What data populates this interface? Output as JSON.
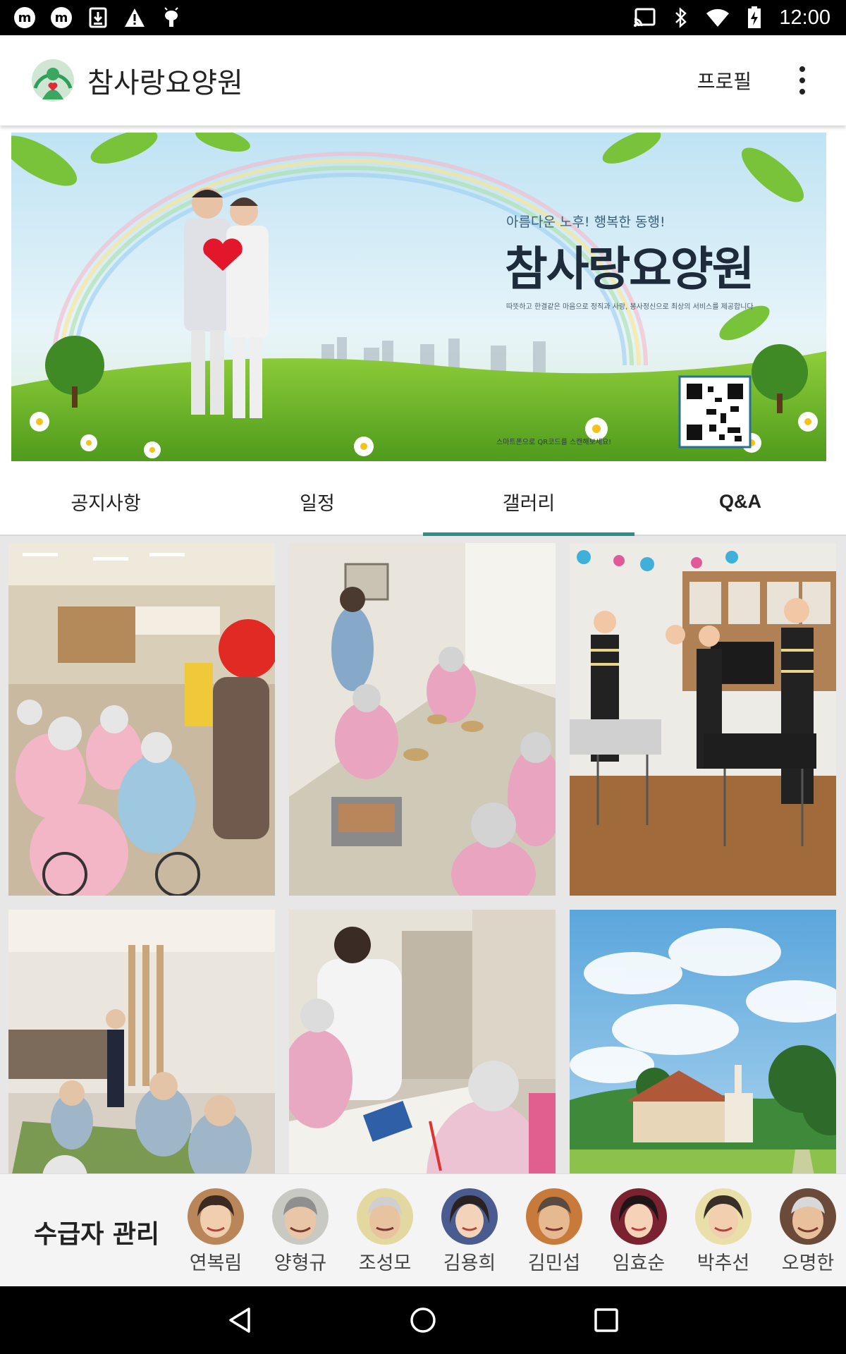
{
  "status_bar": {
    "time": "12:00",
    "left_icons": [
      "m-cast-icon",
      "m-app-icon",
      "download-icon",
      "warning-icon",
      "android-icon"
    ],
    "right_icons": [
      "cast-icon",
      "bluetooth-icon",
      "wifi-icon",
      "battery-charging-icon"
    ]
  },
  "app_bar": {
    "title": "참사랑요양원",
    "profile_label": "프로필",
    "accent": "#2b8f84"
  },
  "banner": {
    "tagline": "아름다운 노후! 행복한 동행!",
    "name": "참사랑요양원",
    "description": "따뜻하고 한결같은 마음으로 정직과 사랑, 봉사정신으로 최상의 서비스를 제공합니다",
    "qr_caption": "스마트폰으로 QR코드를 스캔해보세요!"
  },
  "tabs": [
    {
      "label": "공지사항",
      "active": false
    },
    {
      "label": "일정",
      "active": false
    },
    {
      "label": "갤러리",
      "active": true
    },
    {
      "label": "Q&A",
      "active": false
    }
  ],
  "gallery": {
    "photos": [
      "recreation-photo",
      "meal-photo",
      "music-performance-photo",
      "activity-room-photo",
      "care-photo",
      "building-photo"
    ]
  },
  "recipients": {
    "title": "수급자 관리",
    "people": [
      {
        "name": "연복림"
      },
      {
        "name": "양형규"
      },
      {
        "name": "조성모"
      },
      {
        "name": "김용희"
      },
      {
        "name": "김민섭"
      },
      {
        "name": "임효순"
      },
      {
        "name": "박추선"
      },
      {
        "name": "오명한"
      }
    ]
  },
  "nav_bar": {
    "buttons": [
      "back-icon",
      "home-icon",
      "recents-icon"
    ]
  }
}
